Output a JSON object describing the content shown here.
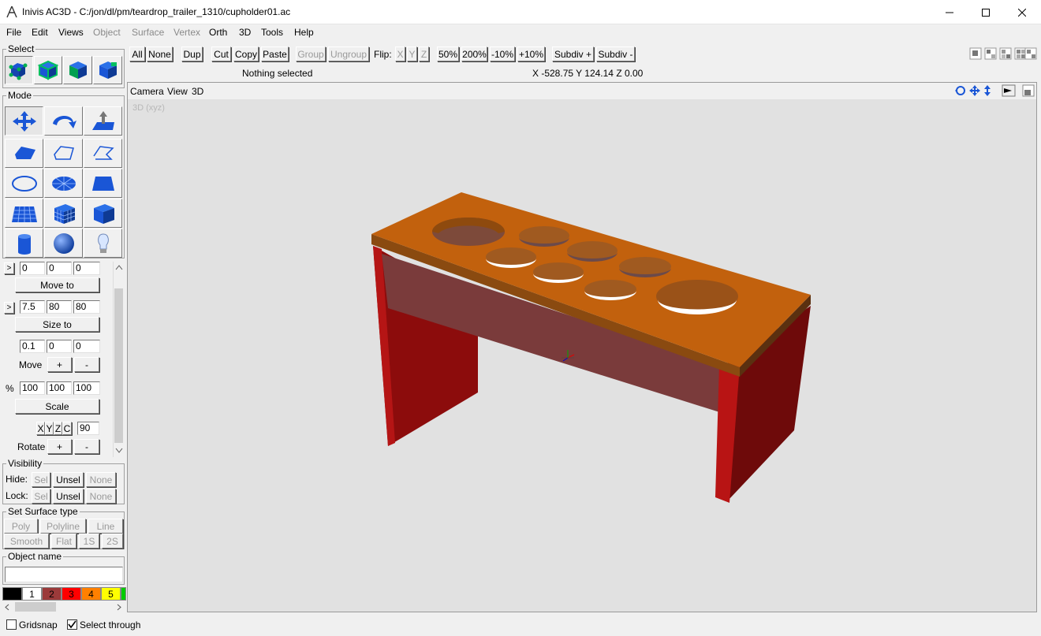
{
  "window": {
    "title": "Inivis AC3D - C:/jon/dl/pm/teardrop_trailer_1310/cupholder01.ac"
  },
  "menu": [
    {
      "label": "File",
      "enabled": true
    },
    {
      "label": "Edit",
      "enabled": true
    },
    {
      "label": "Views",
      "enabled": true
    },
    {
      "label": "Object",
      "enabled": false
    },
    {
      "label": "Surface",
      "enabled": false
    },
    {
      "label": "Vertex",
      "enabled": false
    },
    {
      "label": "Orth",
      "enabled": true
    },
    {
      "label": "3D",
      "enabled": true
    },
    {
      "label": "Tools",
      "enabled": true
    },
    {
      "label": "Help",
      "enabled": true
    }
  ],
  "toolbar": {
    "all": "All",
    "none": "None",
    "dup": "Dup",
    "cut": "Cut",
    "copy": "Copy",
    "paste": "Paste",
    "group": "Group",
    "ungroup": "Ungroup",
    "flip": "Flip:",
    "flip_x": "X",
    "flip_y": "Y",
    "flip_z": "Z",
    "zoom50": "50%",
    "zoom200": "200%",
    "minus10": "-10%",
    "plus10": "+10%",
    "subdiv_plus": "Subdiv +",
    "subdiv_minus": "Subdiv -"
  },
  "status": {
    "selection": "Nothing selected",
    "coords": "X -528.75 Y 124.14 Z 0.00"
  },
  "left_panel": {
    "select_title": "Select",
    "mode_title": "Mode",
    "move_values": [
      "0",
      "0",
      "0"
    ],
    "move_to": "Move to",
    "size_values": [
      "7.5",
      "80",
      "80"
    ],
    "size_to": "Size to",
    "move_step": [
      "0.1",
      "0",
      "0"
    ],
    "move_label": "Move",
    "plus": "+",
    "minus": "-",
    "arrow": ">",
    "percent": "%",
    "scale_values": [
      "100",
      "100",
      "100"
    ],
    "scale": "Scale",
    "rot_axes": [
      "X",
      "Y",
      "Z",
      "C"
    ],
    "rot_angle": "90",
    "rotate_label": "Rotate",
    "visibility_title": "Visibility",
    "hide": "Hide:",
    "lock": "Lock:",
    "sel": "Sel",
    "unsel": "Unsel",
    "none": "None",
    "surface_title": "Set Surface type",
    "poly": "Poly",
    "polyline": "Polyline",
    "line": "Line",
    "smooth": "Smooth",
    "flat": "Flat",
    "one_s": "1S",
    "two_s": "2S",
    "object_name_title": "Object name",
    "object_name_value": ""
  },
  "palette": [
    {
      "label": "",
      "color": "#000000"
    },
    {
      "label": "1",
      "color": "#ffffff"
    },
    {
      "label": "2",
      "color": "#9b3a3a"
    },
    {
      "label": "3",
      "color": "#ff0000"
    },
    {
      "label": "4",
      "color": "#ff8000"
    },
    {
      "label": "5",
      "color": "#ffff00"
    },
    {
      "label": "",
      "color": "#00cc00"
    }
  ],
  "viewport": {
    "menu_camera": "Camera",
    "menu_view": "View",
    "menu_3d": "3D",
    "label": "3D (xyz)"
  },
  "bottom": {
    "gridsnap": "Gridsnap",
    "gridsnap_checked": false,
    "select_through": "Select through",
    "select_through_checked": true
  },
  "colors": {
    "model_top": "#c4620c",
    "model_red": "#a50e0e",
    "model_panel": "#7f3a3a",
    "tool_blue": "#1a56d6"
  }
}
